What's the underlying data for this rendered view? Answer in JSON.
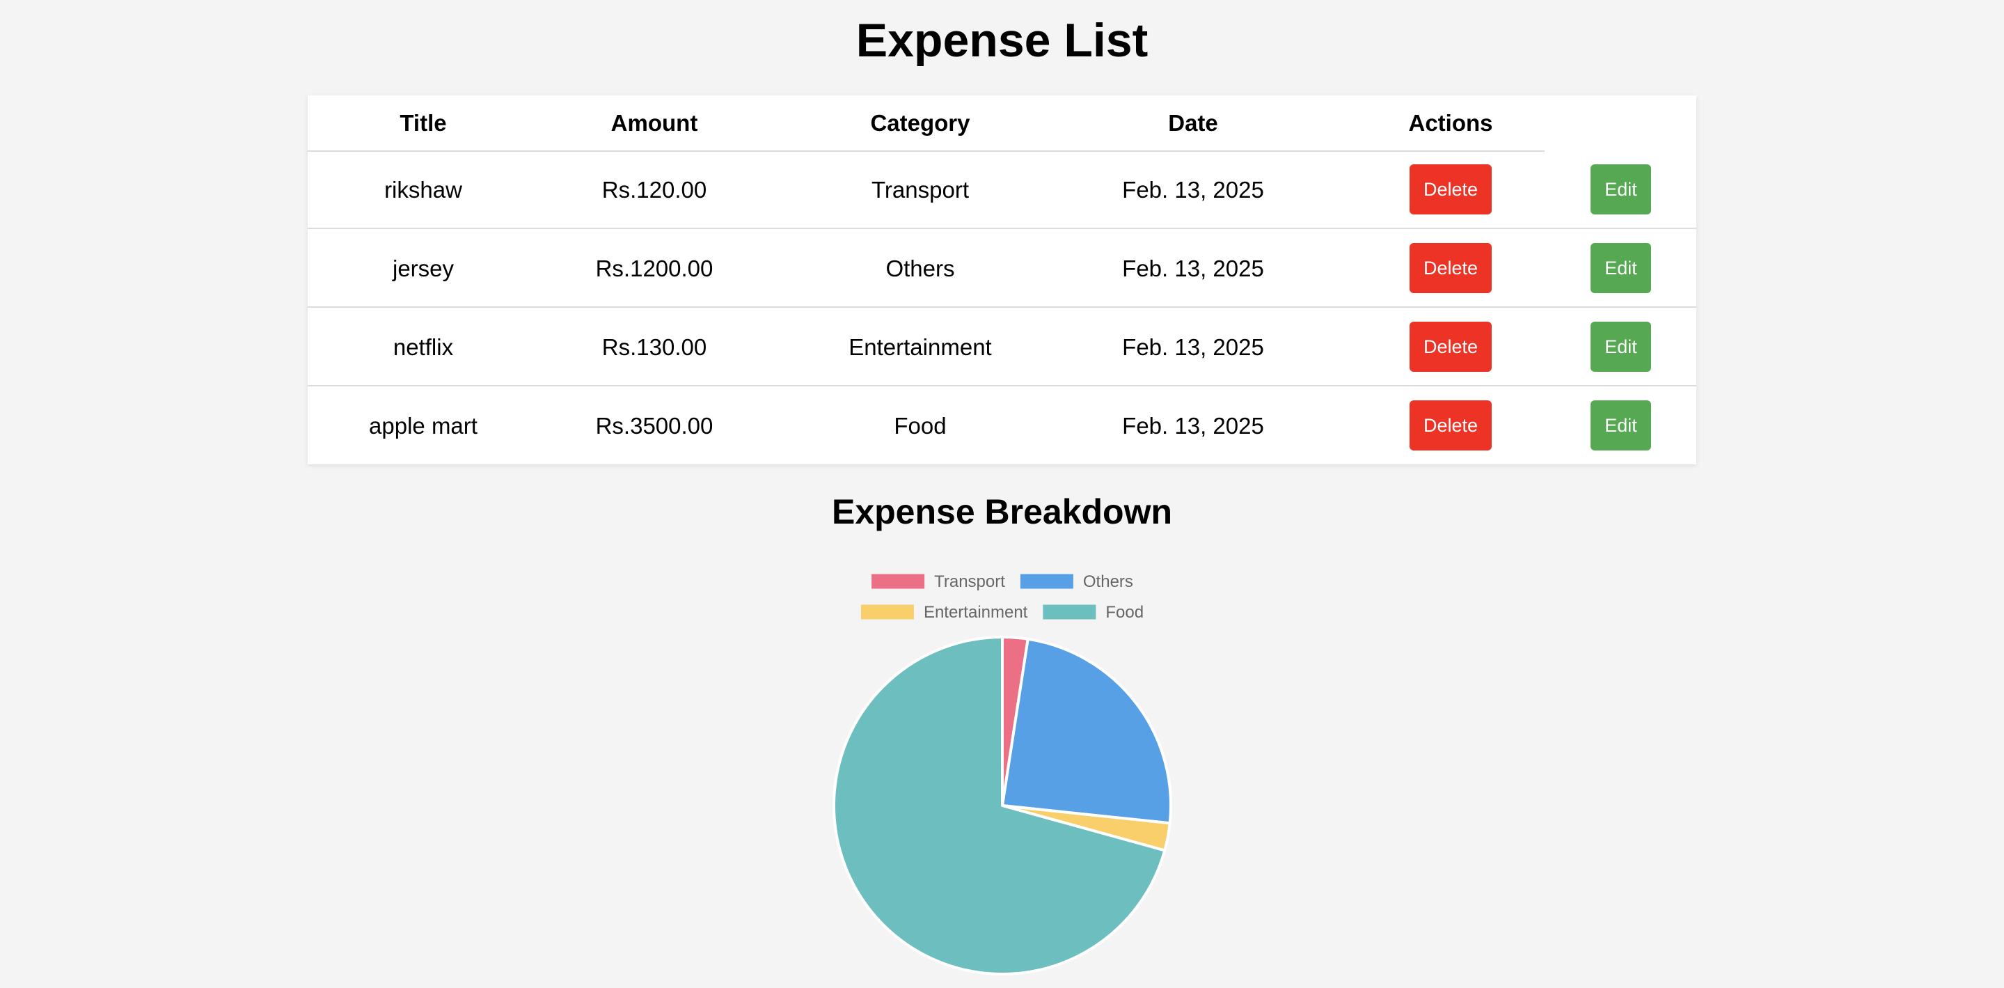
{
  "page": {
    "title": "Expense List"
  },
  "table": {
    "headers": [
      "Title",
      "Amount",
      "Category",
      "Date",
      "Actions"
    ],
    "rows": [
      {
        "title": "rikshaw",
        "amount": "Rs.120.00",
        "category": "Transport",
        "date": "Feb. 13, 2025",
        "delete_label": "Delete",
        "edit_label": "Edit"
      },
      {
        "title": "jersey",
        "amount": "Rs.1200.00",
        "category": "Others",
        "date": "Feb. 13, 2025",
        "delete_label": "Delete",
        "edit_label": "Edit"
      },
      {
        "title": "netflix",
        "amount": "Rs.130.00",
        "category": "Entertainment",
        "date": "Feb. 13, 2025",
        "delete_label": "Delete",
        "edit_label": "Edit"
      },
      {
        "title": "apple mart",
        "amount": "Rs.3500.00",
        "category": "Food",
        "date": "Feb. 13, 2025",
        "delete_label": "Delete",
        "edit_label": "Edit"
      }
    ]
  },
  "breakdown": {
    "title": "Expense Breakdown"
  },
  "colors": {
    "delete": "#ec3326",
    "edit": "#56a852",
    "background": "#f4f4f4"
  },
  "chart_data": {
    "type": "pie",
    "title": "Expense Breakdown",
    "categories": [
      "Transport",
      "Others",
      "Entertainment",
      "Food"
    ],
    "values": [
      120,
      1200,
      130,
      3500
    ],
    "colors": [
      "#ed6f85",
      "#57a0e5",
      "#f8cf6b",
      "#6cbebf"
    ],
    "legend_position": "top"
  }
}
